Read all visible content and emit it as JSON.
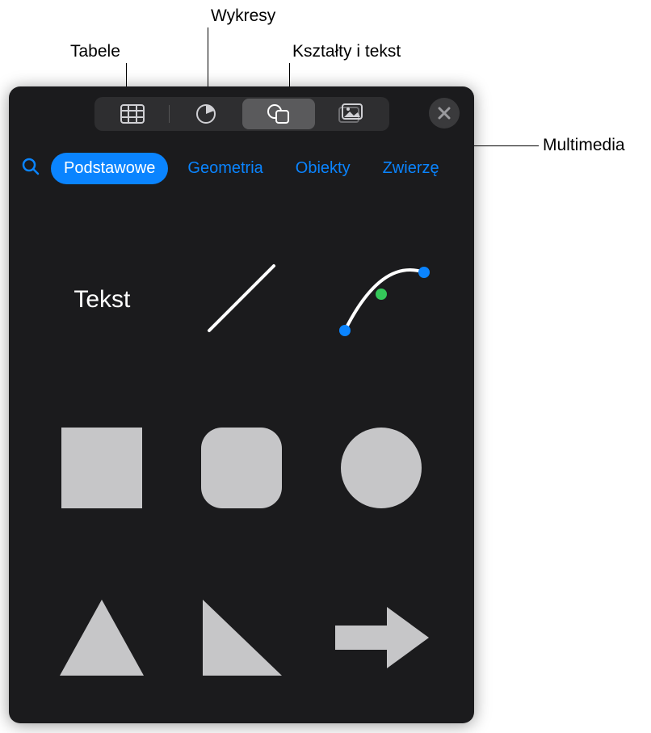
{
  "callouts": {
    "tables": "Tabele",
    "charts": "Wykresy",
    "shapes_text": "Kształty i tekst",
    "media": "Multimedia"
  },
  "toolbar": {
    "tables_icon": "table-icon",
    "charts_icon": "pie-chart-icon",
    "shapes_icon": "shapes-icon",
    "media_icon": "media-icon",
    "close_icon": "close-icon"
  },
  "search": {
    "placeholder": "Szukaj"
  },
  "chips": {
    "basic": "Podstawowe",
    "geometry": "Geometria",
    "objects": "Obiekty",
    "animals": "Zwierzę"
  },
  "shape_labels": {
    "text": "Tekst"
  },
  "colors": {
    "accent": "#0a84ff",
    "panel_bg": "#1b1b1d",
    "shape_fill": "#c6c6c8"
  }
}
